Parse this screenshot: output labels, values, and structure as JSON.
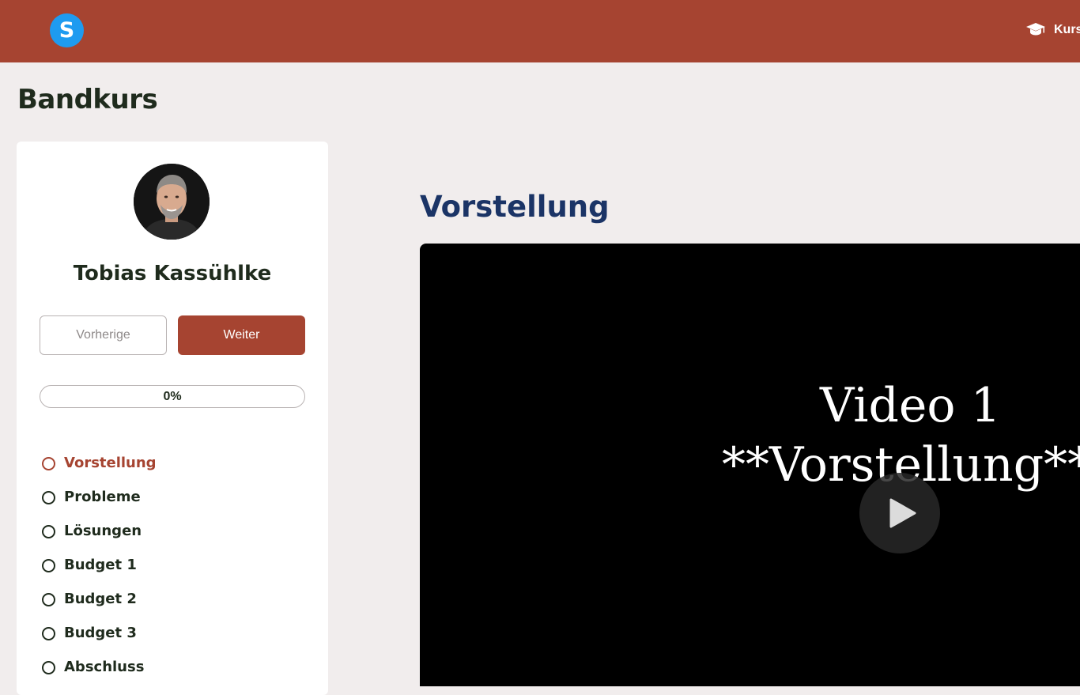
{
  "header": {
    "logo_letter": "S",
    "nav_label": "Kurs",
    "nav_icon": "graduation-cap-icon",
    "brand_color": "#a64431",
    "logo_color": "#1e9bf0"
  },
  "course": {
    "title": "Bandkurs"
  },
  "sidebar": {
    "instructor_name": "Tobias Kassühlke",
    "prev_label": "Vorherige",
    "next_label": "Weiter",
    "progress_text": "0%",
    "progress_fraction": 0,
    "lessons": [
      {
        "label": "Vorstellung",
        "active": true
      },
      {
        "label": "Probleme",
        "active": false
      },
      {
        "label": "Lösungen",
        "active": false
      },
      {
        "label": "Budget 1",
        "active": false
      },
      {
        "label": "Budget 2",
        "active": false
      },
      {
        "label": "Budget 3",
        "active": false
      },
      {
        "label": "Abschluss",
        "active": false
      }
    ]
  },
  "main": {
    "lesson_title": "Vorstellung",
    "video_line1": "Video 1",
    "video_line2": "**Vorstellung**",
    "play_icon": "play-icon"
  }
}
